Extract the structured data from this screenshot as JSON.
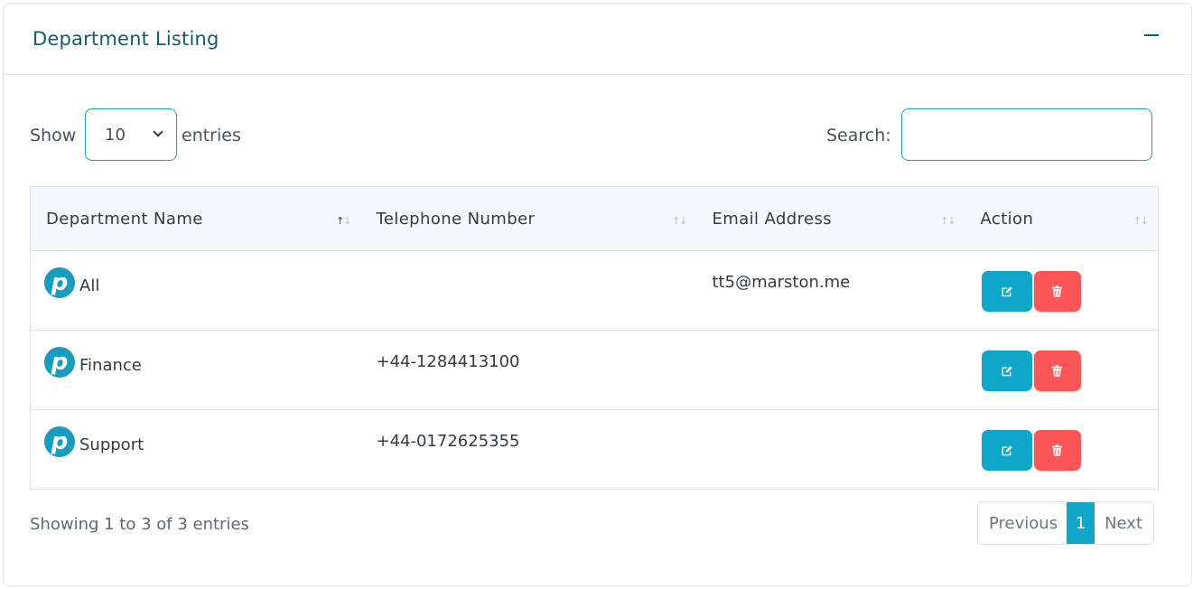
{
  "card": {
    "title": "Department Listing",
    "collapse_icon": "minus-icon"
  },
  "controls": {
    "show_label": "Show",
    "length_value": "10",
    "entries_label": "entries",
    "search_label": "Search:",
    "search_value": ""
  },
  "table": {
    "columns": [
      "Department Name",
      "Telephone Number",
      "Email Address",
      "Action"
    ],
    "sorted_column": "Department Name",
    "rows": [
      {
        "name": "All",
        "telephone": "",
        "email": "tt5@marston.me"
      },
      {
        "name": "Finance",
        "telephone": "+44-1284413100",
        "email": ""
      },
      {
        "name": "Support",
        "telephone": "+44-0172625355",
        "email": ""
      }
    ],
    "row_logo_letter": "p",
    "action_icons": {
      "edit": "edit-icon",
      "delete": "trash-icon"
    }
  },
  "footer": {
    "info": "Showing 1 to 3 of 3 entries",
    "previous": "Previous",
    "current_page": "1",
    "next": "Next"
  },
  "colors": {
    "accent": "#0fa7c9",
    "danger": "#fb5655",
    "title": "#0f5c78"
  }
}
